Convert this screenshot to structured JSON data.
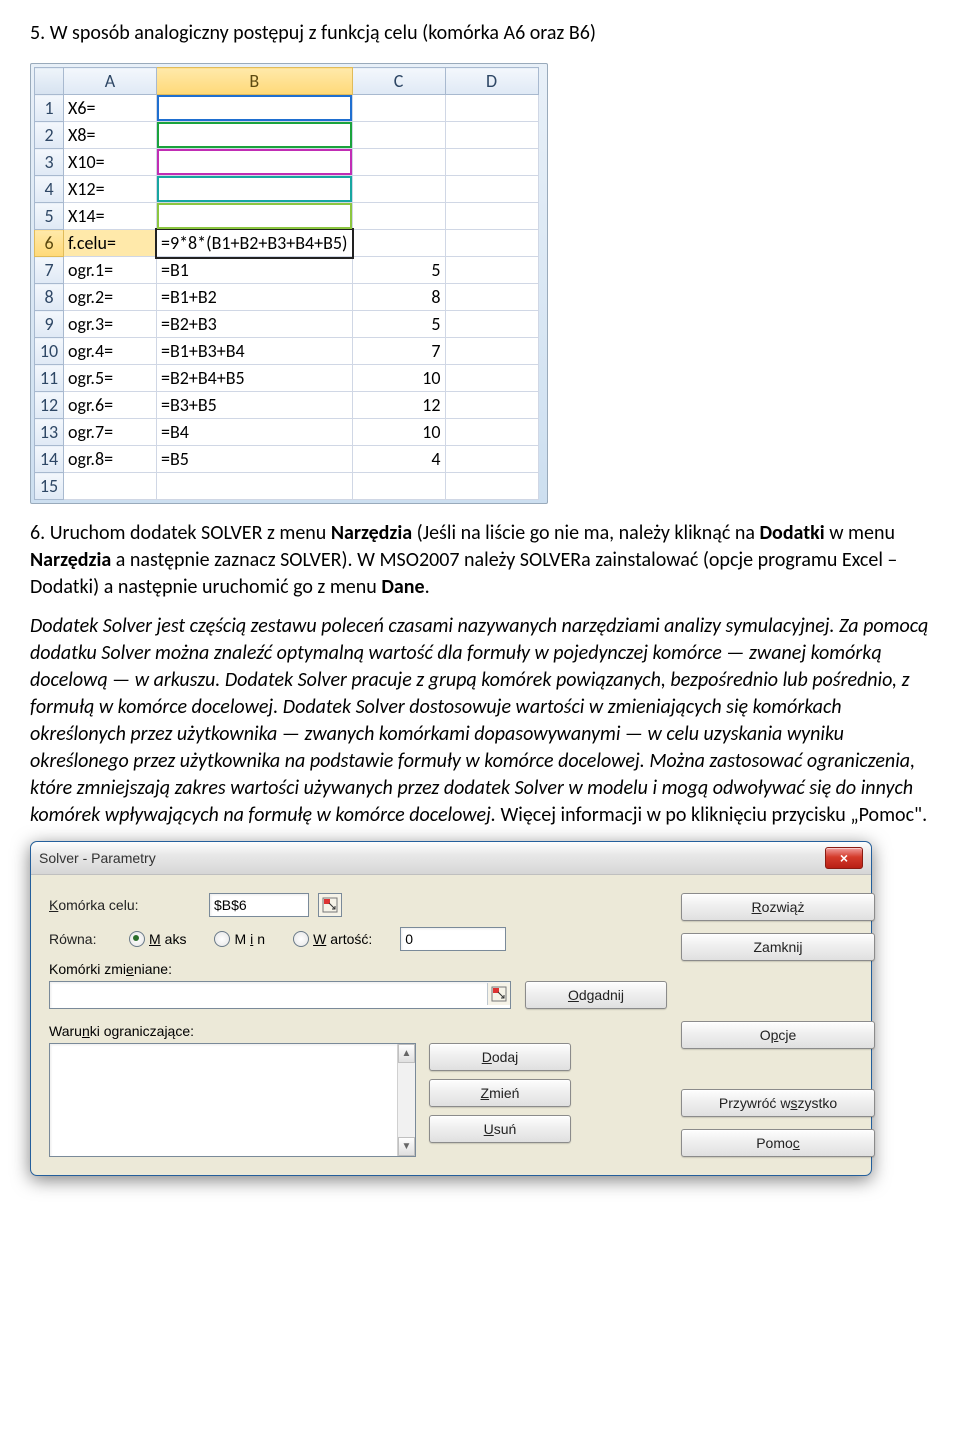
{
  "step5": {
    "num": "5.",
    "text": "W sposób analogiczny postępuj z funkcją celu (komórka A6 oraz B6)"
  },
  "sheet": {
    "cols": [
      "A",
      "B",
      "C",
      "D"
    ],
    "selectedCol": "B",
    "selectedRow": "6",
    "rows": [
      {
        "n": "1",
        "a": "X6=",
        "b": "",
        "c": "",
        "bClass": "outline c-blue"
      },
      {
        "n": "2",
        "a": "X8=",
        "b": "",
        "c": "",
        "bClass": "outline c-green"
      },
      {
        "n": "3",
        "a": "X10=",
        "b": "",
        "c": "",
        "bClass": "outline c-magenta"
      },
      {
        "n": "4",
        "a": "X12=",
        "b": "",
        "c": "",
        "bClass": "outline c-teal"
      },
      {
        "n": "5",
        "a": "X14=",
        "b": "",
        "c": "",
        "bClass": "outline c-lime"
      },
      {
        "n": "6",
        "a": "f.celu=",
        "b": "=9*8*(B1+B2+B3+B4+B5)",
        "c": "",
        "sel": true
      },
      {
        "n": "7",
        "a": "ogr.1=",
        "b": "=B1",
        "c": "5"
      },
      {
        "n": "8",
        "a": "ogr.2=",
        "b": "=B1+B2",
        "c": "8"
      },
      {
        "n": "9",
        "a": "ogr.3=",
        "b": "=B2+B3",
        "c": "5"
      },
      {
        "n": "10",
        "a": "ogr.4=",
        "b": "=B1+B3+B4",
        "c": "7"
      },
      {
        "n": "11",
        "a": "ogr.5=",
        "b": "=B2+B4+B5",
        "c": "10"
      },
      {
        "n": "12",
        "a": "ogr.6=",
        "b": "=B3+B5",
        "c": "12"
      },
      {
        "n": "13",
        "a": "ogr.7=",
        "b": "=B4",
        "c": "10"
      },
      {
        "n": "14",
        "a": "ogr.8=",
        "b": "=B5",
        "c": "4"
      },
      {
        "n": "15",
        "a": "",
        "b": "",
        "c": "",
        "half": true
      }
    ]
  },
  "step6": {
    "num": "6.",
    "part1": "Uruchom dodatek SOLVER  z menu ",
    "b1": "Narzędzia",
    "part2": " (Jeśli na liście go nie ma, należy kliknąć na ",
    "b2": "Dodatki",
    "part3": " w menu ",
    "b3": "Narzędzia",
    "part4": " a następnie zaznacz SOLVER). W MSO2007 należy SOLVERa zainstalować (opcje programu Excel – Dodatki) a następnie uruchomić go z menu ",
    "b4": "Dane",
    "part5": "."
  },
  "note": {
    "p1": "Dodatek Solver jest częścią zestawu poleceń czasami nazywanych narzędziami analizy symulacyjnej. Za pomocą dodatku Solver można znaleźć optymalną wartość dla formuły w pojedynczej komórce — zwanej komórką docelową — w arkuszu. Dodatek Solver pracuje z grupą komórek powiązanych, bezpośrednio lub pośrednio, z formułą w komórce docelowej. Dodatek Solver dostosowuje wartości w zmieniających się komórkach określonych przez użytkownika — zwanych komórkami dopasowywanymi — w celu uzyskania wyniku określonego przez użytkownika na podstawie formuły w komórce docelowej. Można zastosować ograniczenia, które zmniejszają zakres wartości używanych przez dodatek Solver w modelu i mogą odwoływać się do innych komórek wpływających na formułę w komórce docelowej.",
    "p2": " Więcej informacji w po kliknięciu przycisku „Pomoc\"."
  },
  "dlg": {
    "title": "Solver - Parametry",
    "close": "×",
    "targetLabel": "Komórka celu:",
    "targetValue": "$B$6",
    "equalLabel": "Równa:",
    "optMax": "Maks",
    "optMin": "Min",
    "optVal": "Wartość:",
    "valBox": "0",
    "changingLabel": "Komórki zmieniane:",
    "constraintsLabel": "Warunki ograniczające:",
    "btnSolve": "Rozwiąż",
    "btnClose": "Zamknij",
    "btnGuess": "Odgadnij",
    "btnOptions": "Opcje",
    "btnAdd": "Dodaj",
    "btnChange": "Zmień",
    "btnDelete": "Usuń",
    "btnReset": "Przywróć wszystko",
    "btnHelp": "Pomoc"
  }
}
